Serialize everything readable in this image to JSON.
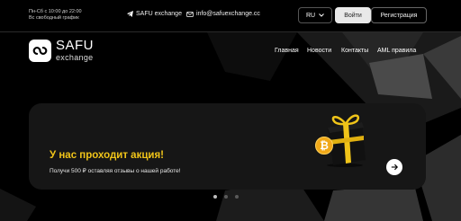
{
  "topbar": {
    "hours_line1": "Пн-Сб с 10:00 до 22:00",
    "hours_line2": "Вс свободный график",
    "telegram_label": "SAFU exchange",
    "email_label": "info@safuexchange.cc",
    "language": "RU",
    "login_label": "Войти",
    "register_label": "Регистрация"
  },
  "header": {
    "logo_title": "SAFU",
    "logo_subtitle": "exchange",
    "nav": [
      "Главная",
      "Новости",
      "Контакты",
      "AML правила"
    ]
  },
  "banner": {
    "title": "У нас проходит акция!",
    "text": "Получи 500 ₽ оставляя отзывы о нашей работе!",
    "coin_symbol": "₿",
    "active_slide": 1,
    "slide_count": 3
  },
  "colors": {
    "accent": "#f0c419",
    "background": "#000000",
    "card": "#161616",
    "button_light": "#e9e9e9"
  }
}
